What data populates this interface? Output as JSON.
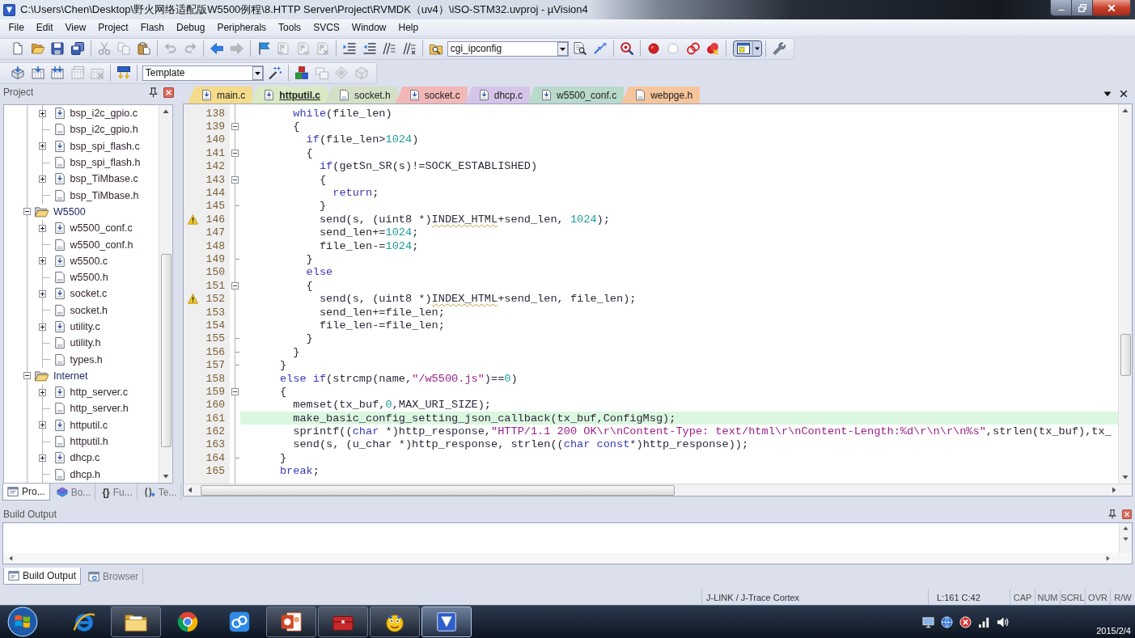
{
  "window": {
    "title": "C:\\Users\\Chen\\Desktop\\野火网络适配版W5500例程\\8.HTTP Server\\Project\\RVMDK（uv4）\\iSO-STM32.uvproj - µVision4"
  },
  "menu": [
    "File",
    "Edit",
    "View",
    "Project",
    "Flash",
    "Debug",
    "Peripherals",
    "Tools",
    "SVCS",
    "Window",
    "Help"
  ],
  "toolbar_1": [
    {
      "kind": "new",
      "disabled": false
    },
    {
      "kind": "open",
      "disabled": false
    },
    {
      "kind": "save",
      "disabled": false
    },
    {
      "kind": "saveall",
      "disabled": false
    },
    {
      "kind": "separator"
    },
    {
      "kind": "cut",
      "disabled": true
    },
    {
      "kind": "copy",
      "disabled": true
    },
    {
      "kind": "paste",
      "disabled": false
    },
    {
      "kind": "separator"
    },
    {
      "kind": "undo",
      "disabled": true
    },
    {
      "kind": "redo",
      "disabled": true
    },
    {
      "kind": "separator"
    },
    {
      "kind": "back",
      "disabled": false
    },
    {
      "kind": "forward",
      "disabled": true
    },
    {
      "kind": "separator"
    },
    {
      "kind": "bookmark",
      "disabled": false
    },
    {
      "kind": "prevmark",
      "disabled": true
    },
    {
      "kind": "nextmark",
      "disabled": true
    },
    {
      "kind": "clearmarks",
      "disabled": true
    },
    {
      "kind": "separator"
    },
    {
      "kind": "indent",
      "disabled": false
    },
    {
      "kind": "outdent",
      "disabled": false
    },
    {
      "kind": "comment",
      "disabled": false
    },
    {
      "kind": "uncomment",
      "disabled": false
    },
    {
      "kind": "separator"
    },
    {
      "kind": "findfiles",
      "disabled": false
    },
    {
      "kind": "combo",
      "value": "cgi_ipconfig"
    },
    {
      "kind": "find",
      "disabled": false
    },
    {
      "kind": "incfind",
      "disabled": false
    },
    {
      "kind": "separator"
    },
    {
      "kind": "debug",
      "disabled": false
    },
    {
      "kind": "separator"
    },
    {
      "kind": "breakpoint",
      "disabled": false
    },
    {
      "kind": "bpdisable",
      "disabled": false
    },
    {
      "kind": "bptoggle",
      "disabled": false
    },
    {
      "kind": "bpkill",
      "disabled": false
    },
    {
      "kind": "separator"
    },
    {
      "kind": "layout",
      "disabled": false
    },
    {
      "kind": "separator"
    },
    {
      "kind": "wrench",
      "disabled": false
    }
  ],
  "toolbar_2": [
    {
      "kind": "translate",
      "disabled": false
    },
    {
      "kind": "build",
      "disabled": false
    },
    {
      "kind": "rebuild",
      "disabled": false
    },
    {
      "kind": "batch",
      "disabled": true
    },
    {
      "kind": "stop",
      "disabled": true
    },
    {
      "kind": "separator"
    },
    {
      "kind": "download",
      "disabled": false
    },
    {
      "kind": "separator"
    },
    {
      "kind": "combo",
      "value": "Template"
    },
    {
      "kind": "options",
      "disabled": false
    },
    {
      "kind": "separator"
    },
    {
      "kind": "components",
      "disabled": false
    },
    {
      "kind": "environment",
      "disabled": true
    },
    {
      "kind": "packs",
      "disabled": true
    },
    {
      "kind": "installer",
      "disabled": true
    }
  ],
  "project_panel": {
    "title": "Project",
    "scrolled_group_files": [
      {
        "label": "bsp_i2c_gpio.c",
        "kind": "source",
        "expanded": false
      },
      {
        "label": "bsp_i2c_gpio.h",
        "kind": "header"
      },
      {
        "label": "bsp_spi_flash.c",
        "kind": "source",
        "expanded": false
      },
      {
        "label": "bsp_spi_flash.h",
        "kind": "header"
      },
      {
        "label": "bsp_TiMbase.c",
        "kind": "source",
        "expanded": false
      },
      {
        "label": "bsp_TiMbase.h",
        "kind": "header"
      }
    ],
    "groups": [
      {
        "label": "W5500",
        "expanded": true,
        "children": [
          {
            "label": "w5500_conf.c",
            "kind": "source",
            "expanded": false
          },
          {
            "label": "w5500_conf.h",
            "kind": "header"
          },
          {
            "label": "w5500.c",
            "kind": "source",
            "expanded": false
          },
          {
            "label": "w5500.h",
            "kind": "header"
          },
          {
            "label": "socket.c",
            "kind": "source",
            "expanded": false
          },
          {
            "label": "socket.h",
            "kind": "header"
          },
          {
            "label": "utility.c",
            "kind": "source",
            "expanded": false
          },
          {
            "label": "utility.h",
            "kind": "header"
          },
          {
            "label": "types.h",
            "kind": "header"
          }
        ]
      },
      {
        "label": "Internet",
        "expanded": true,
        "children": [
          {
            "label": "http_server.c",
            "kind": "source",
            "expanded": false
          },
          {
            "label": "http_server.h",
            "kind": "header"
          },
          {
            "label": "httputil.c",
            "kind": "source",
            "expanded": false
          },
          {
            "label": "httputil.h",
            "kind": "header"
          },
          {
            "label": "dhcp.c",
            "kind": "source",
            "expanded": false
          },
          {
            "label": "dhcp.h",
            "kind": "header"
          }
        ]
      }
    ],
    "tabs": [
      {
        "label": "Pro...",
        "kind": "project",
        "selected": true
      },
      {
        "label": "Bo...",
        "kind": "books",
        "selected": false
      },
      {
        "label": "Fu...",
        "kind": "functions",
        "glyph": "{}",
        "selected": false
      },
      {
        "label": "Te...",
        "kind": "templates",
        "selected": false
      }
    ]
  },
  "editor": {
    "tabs": [
      {
        "label": "main.c",
        "kind": "source",
        "color": "#f5db8a",
        "selected": false
      },
      {
        "label": "httputil.c",
        "kind": "source",
        "color": "#d9eac4",
        "selected": true
      },
      {
        "label": "socket.h",
        "kind": "header",
        "color": "#d3e0c6",
        "selected": false
      },
      {
        "label": "socket.c",
        "kind": "source",
        "color": "#f2b7b7",
        "selected": false
      },
      {
        "label": "dhcp.c",
        "kind": "source",
        "color": "#d5c4e8",
        "selected": false
      },
      {
        "label": "w5500_conf.c",
        "kind": "source",
        "color": "#b9d9cb",
        "selected": false
      },
      {
        "label": "webpge.h",
        "kind": "header",
        "color": "#f6c59c",
        "selected": false
      }
    ],
    "lines": [
      {
        "number": "138",
        "kind": "plain",
        "warning": false,
        "current": false,
        "segments": [
          {
            "kind": "keyword",
            "text": "        while"
          },
          {
            "kind": "plain",
            "text": "(file_len)"
          }
        ]
      },
      {
        "number": "139",
        "kind": "foldstart",
        "warning": false,
        "current": false,
        "segments": [
          {
            "kind": "plain",
            "text": "        {"
          }
        ]
      },
      {
        "number": "140",
        "kind": "plain",
        "warning": false,
        "current": false,
        "segments": [
          {
            "kind": "keyword",
            "text": "          if"
          },
          {
            "kind": "plain",
            "text": "(file_len>"
          },
          {
            "kind": "number",
            "text": "1024"
          },
          {
            "kind": "plain",
            "text": ")"
          }
        ]
      },
      {
        "number": "141",
        "kind": "foldstart",
        "warning": false,
        "current": false,
        "segments": [
          {
            "kind": "plain",
            "text": "          {"
          }
        ]
      },
      {
        "number": "142",
        "kind": "plain",
        "warning": false,
        "current": false,
        "segments": [
          {
            "kind": "keyword",
            "text": "            if"
          },
          {
            "kind": "plain",
            "text": "(getSn_SR(s)!=SOCK_ESTABLISHED)"
          }
        ]
      },
      {
        "number": "143",
        "kind": "foldstart",
        "warning": false,
        "current": false,
        "segments": [
          {
            "kind": "plain",
            "text": "            {"
          }
        ]
      },
      {
        "number": "144",
        "kind": "plain",
        "warning": false,
        "current": false,
        "segments": [
          {
            "kind": "keyword",
            "text": "              return"
          },
          {
            "kind": "plain",
            "text": ";"
          }
        ]
      },
      {
        "number": "145",
        "kind": "foldend",
        "warning": false,
        "current": false,
        "segments": [
          {
            "kind": "plain",
            "text": "            }"
          }
        ]
      },
      {
        "number": "146",
        "kind": "plain",
        "warning": true,
        "current": false,
        "segments": [
          {
            "kind": "plain",
            "text": "            send(s, (uint8 *)"
          },
          {
            "kind": "flagged",
            "text": "INDEX_HTML"
          },
          {
            "kind": "plain",
            "text": "+send_len, "
          },
          {
            "kind": "number",
            "text": "1024"
          },
          {
            "kind": "plain",
            "text": ");"
          }
        ]
      },
      {
        "number": "147",
        "kind": "plain",
        "warning": false,
        "current": false,
        "segments": [
          {
            "kind": "plain",
            "text": "            send_len+="
          },
          {
            "kind": "number",
            "text": "1024"
          },
          {
            "kind": "plain",
            "text": ";"
          }
        ]
      },
      {
        "number": "148",
        "kind": "plain",
        "warning": false,
        "current": false,
        "segments": [
          {
            "kind": "plain",
            "text": "            file_len-="
          },
          {
            "kind": "number",
            "text": "1024"
          },
          {
            "kind": "plain",
            "text": ";"
          }
        ]
      },
      {
        "number": "149",
        "kind": "foldend",
        "warning": false,
        "current": false,
        "segments": [
          {
            "kind": "plain",
            "text": "          }"
          }
        ]
      },
      {
        "number": "150",
        "kind": "plain",
        "warning": false,
        "current": false,
        "segments": [
          {
            "kind": "keyword",
            "text": "          else"
          }
        ]
      },
      {
        "number": "151",
        "kind": "foldstart",
        "warning": false,
        "current": false,
        "segments": [
          {
            "kind": "plain",
            "text": "          {"
          }
        ]
      },
      {
        "number": "152",
        "kind": "plain",
        "warning": true,
        "current": false,
        "segments": [
          {
            "kind": "plain",
            "text": "            send(s, (uint8 *)"
          },
          {
            "kind": "flagged",
            "text": "INDEX_HTML"
          },
          {
            "kind": "plain",
            "text": "+send_len, file_len);"
          }
        ]
      },
      {
        "number": "153",
        "kind": "plain",
        "warning": false,
        "current": false,
        "segments": [
          {
            "kind": "plain",
            "text": "            send_len+=file_len;"
          }
        ]
      },
      {
        "number": "154",
        "kind": "plain",
        "warning": false,
        "current": false,
        "segments": [
          {
            "kind": "plain",
            "text": "            file_len-=file_len;"
          }
        ]
      },
      {
        "number": "155",
        "kind": "foldend",
        "warning": false,
        "current": false,
        "segments": [
          {
            "kind": "plain",
            "text": "          }"
          }
        ]
      },
      {
        "number": "156",
        "kind": "foldend",
        "warning": false,
        "current": false,
        "segments": [
          {
            "kind": "plain",
            "text": "        }"
          }
        ]
      },
      {
        "number": "157",
        "kind": "foldend",
        "warning": false,
        "current": false,
        "segments": [
          {
            "kind": "plain",
            "text": "      }"
          }
        ]
      },
      {
        "number": "158",
        "kind": "plain",
        "warning": false,
        "current": false,
        "segments": [
          {
            "kind": "keyword",
            "text": "      else if"
          },
          {
            "kind": "plain",
            "text": "(strcmp(name,"
          },
          {
            "kind": "string",
            "text": "\"/w5500.js\""
          },
          {
            "kind": "plain",
            "text": ")=="
          },
          {
            "kind": "number",
            "text": "0"
          },
          {
            "kind": "plain",
            "text": ")"
          }
        ]
      },
      {
        "number": "159",
        "kind": "foldstart",
        "warning": false,
        "current": false,
        "segments": [
          {
            "kind": "plain",
            "text": "      {"
          }
        ]
      },
      {
        "number": "160",
        "kind": "plain",
        "warning": false,
        "current": false,
        "segments": [
          {
            "kind": "plain",
            "text": "        memset(tx_buf,"
          },
          {
            "kind": "number",
            "text": "0"
          },
          {
            "kind": "plain",
            "text": ",MAX_URI_SIZE);"
          }
        ]
      },
      {
        "number": "161",
        "kind": "plain",
        "warning": false,
        "current": true,
        "segments": [
          {
            "kind": "plain",
            "text": "        make_basic_config_setting_json_callback(tx_buf,ConfigMsg);"
          }
        ]
      },
      {
        "number": "162",
        "kind": "plain",
        "warning": false,
        "current": false,
        "segments": [
          {
            "kind": "plain",
            "text": "        sprintf(("
          },
          {
            "kind": "keyword",
            "text": "char"
          },
          {
            "kind": "plain",
            "text": " *)http_response,"
          },
          {
            "kind": "string",
            "text": "\"HTTP/1.1 200 OK\\r\\nContent-Type: text/html\\r\\nContent-Length:%d\\r\\n\\r\\n%s\""
          },
          {
            "kind": "plain",
            "text": ",strlen(tx_buf),tx_"
          }
        ]
      },
      {
        "number": "163",
        "kind": "plain",
        "warning": false,
        "current": false,
        "segments": [
          {
            "kind": "plain",
            "text": "        send(s, (u_char *)http_response, strlen(("
          },
          {
            "kind": "keyword",
            "text": "char const"
          },
          {
            "kind": "plain",
            "text": "*)http_response));"
          }
        ]
      },
      {
        "number": "164",
        "kind": "foldend",
        "warning": false,
        "current": false,
        "segments": [
          {
            "kind": "plain",
            "text": "      }"
          }
        ]
      },
      {
        "number": "165",
        "kind": "plain",
        "warning": false,
        "current": false,
        "segments": [
          {
            "kind": "keyword",
            "text": "      break"
          },
          {
            "kind": "plain",
            "text": ";"
          }
        ]
      }
    ]
  },
  "build_output": {
    "title": "Build Output",
    "tabs": [
      {
        "label": "Build Output",
        "kind": "output",
        "selected": true
      },
      {
        "label": "Browser",
        "kind": "browser",
        "selected": false
      }
    ]
  },
  "status_bar": {
    "debugger": "J-LINK / J-Trace Cortex",
    "position": "L:161 C:42",
    "indicators": [
      "CAP",
      "NUM",
      "SCRL",
      "OVR",
      "R/W"
    ]
  },
  "taskbar": {
    "apps": [
      {
        "kind": "ie",
        "running": false,
        "selected": false
      },
      {
        "kind": "explorer",
        "running": true,
        "selected": false
      },
      {
        "kind": "chrome",
        "running": false,
        "selected": false
      },
      {
        "kind": "cloud",
        "running": false,
        "selected": false
      },
      {
        "kind": "slides",
        "running": true,
        "selected": false
      },
      {
        "kind": "toolbox",
        "running": true,
        "selected": false
      },
      {
        "kind": "mascot",
        "running": true,
        "selected": false
      },
      {
        "kind": "uvision",
        "running": true,
        "selected": true
      }
    ],
    "date": "2015/2/4"
  }
}
